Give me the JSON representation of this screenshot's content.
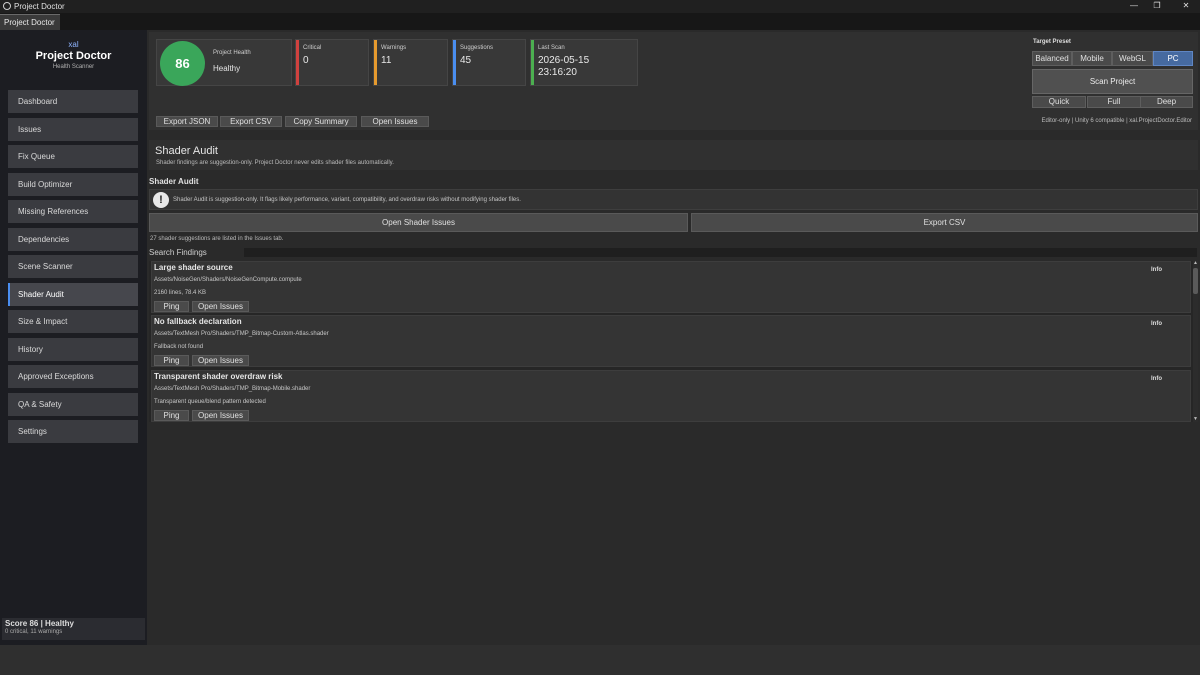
{
  "window": {
    "title": "Project Doctor",
    "tab": "Project Doctor",
    "min_icon": "minimize-icon",
    "max_icon": "maximize-icon",
    "close_icon": "close-icon",
    "min_glyph": "—",
    "max_glyph": "❐",
    "close_glyph": "✕"
  },
  "sidebar": {
    "brand_tag": "xal",
    "brand_name": "Project Doctor",
    "brand_sub": "Health Scanner",
    "items": [
      {
        "label": "Dashboard"
      },
      {
        "label": "Issues"
      },
      {
        "label": "Fix Queue"
      },
      {
        "label": "Build Optimizer"
      },
      {
        "label": "Missing References"
      },
      {
        "label": "Dependencies"
      },
      {
        "label": "Scene Scanner"
      },
      {
        "label": "Shader Audit",
        "active": true
      },
      {
        "label": "Size & Impact"
      },
      {
        "label": "History"
      },
      {
        "label": "Approved Exceptions"
      },
      {
        "label": "QA & Safety"
      },
      {
        "label": "Settings"
      }
    ],
    "footer_score": "Score 86 | Healthy",
    "footer_counts": "0 critical, 11 warnings"
  },
  "header": {
    "health_score": "86",
    "health_label": "Project Health",
    "health_status": "Healthy",
    "health_color": "#3aa65a",
    "stats": [
      {
        "label": "Critical",
        "value": "0",
        "color": "#d0413e"
      },
      {
        "label": "Warnings",
        "value": "11",
        "color": "#e69a2e"
      },
      {
        "label": "Suggestions",
        "value": "45",
        "color": "#4a8ef0"
      },
      {
        "label": "Last Scan",
        "value": "2026-05-15",
        "value2": "23:16:20",
        "color": "#4caf50"
      }
    ],
    "actions": {
      "export_json": "Export JSON",
      "export_csv": "Export CSV",
      "copy_summary": "Copy Summary",
      "open_issues": "Open Issues"
    },
    "preset": {
      "label": "Target Preset",
      "options": [
        "Balanced",
        "Mobile",
        "WebGL",
        "PC"
      ],
      "selected": "PC",
      "accent": "#466aa0"
    },
    "scan_button": "Scan Project",
    "depth": [
      "Quick",
      "Full",
      "Deep"
    ],
    "compat": "Editor-only | Unity 6 compatible | xal.ProjectDoctor.Editor"
  },
  "section": {
    "title": "Shader Audit",
    "desc": "Shader findings are suggestion-only. Project Doctor never edits shader files automatically.",
    "audit_label": "Shader Audit",
    "info_icon": "exclamation-icon",
    "info_glyph": "!",
    "info_text": "Shader Audit is suggestion-only. It flags likely performance, variant, compatibility, and overdraw risks without modifying shader files.",
    "open_shader_issues": "Open Shader Issues",
    "export_csv": "Export CSV",
    "count_note": "27 shader suggestions are listed in the Issues tab.",
    "search_label": "Search Findings",
    "search_value": ""
  },
  "findings": [
    {
      "title": "Large shader source",
      "path": "Assets/NoiseGen/Shaders/NoiseGenCompute.compute",
      "detail": "2160 lines, 78.4 KB",
      "severity": "Info",
      "ping": "Ping",
      "open": "Open Issues"
    },
    {
      "title": "No fallback declaration",
      "path": "Assets/TextMesh Pro/Shaders/TMP_Bitmap-Custom-Atlas.shader",
      "detail": "Fallback not found",
      "severity": "Info",
      "ping": "Ping",
      "open": "Open Issues"
    },
    {
      "title": "Transparent shader overdraw risk",
      "path": "Assets/TextMesh Pro/Shaders/TMP_Bitmap-Mobile.shader",
      "detail": "Transparent queue/blend pattern detected",
      "severity": "Info",
      "ping": "Ping",
      "open": "Open Issues"
    }
  ],
  "scroll": {
    "up_glyph": "▲",
    "down_glyph": "▼"
  }
}
